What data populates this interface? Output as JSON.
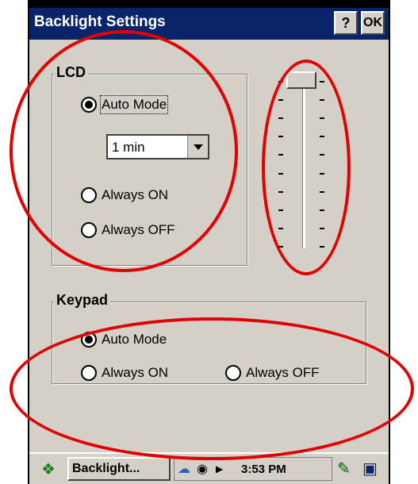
{
  "window": {
    "title": "Backlight Settings",
    "help_label": "?",
    "ok_label": "OK"
  },
  "lcd": {
    "group_label": "LCD",
    "options": [
      "Auto Mode",
      "Always ON",
      "Always OFF"
    ],
    "selected": "Auto Mode",
    "timeout_value": "1 min"
  },
  "brightness": {
    "level_fraction": 1.0
  },
  "keypad": {
    "group_label": "Keypad",
    "options": [
      "Auto Mode",
      "Always ON",
      "Always OFF"
    ],
    "selected": "Auto Mode"
  },
  "taskbar": {
    "task_label": "Backlight...",
    "clock": "3:53 PM"
  },
  "colors": {
    "titlebar": "#0a246a",
    "dialog_bg": "#d4d0c8",
    "annotation": "#e00000"
  }
}
